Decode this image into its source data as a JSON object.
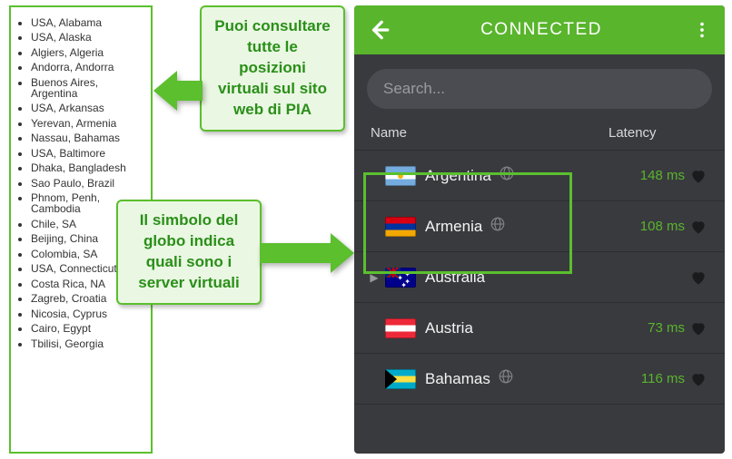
{
  "locations": [
    "USA, Alabama",
    "USA, Alaska",
    "Algiers, Algeria",
    "Andorra, Andorra",
    "Buenos Aires, Argentina",
    "USA, Arkansas",
    "Yerevan, Armenia",
    "Nassau, Bahamas",
    "USA, Baltimore",
    "Dhaka, Bangladesh",
    "Sao Paulo, Brazil",
    "Phnom, Penh, Cambodia",
    "Chile, SA",
    "Beijing, China",
    "Colombia, SA",
    "USA, Connecticut",
    "Costa Rica, NA",
    "Zagreb, Croatia",
    "Nicosia, Cyprus",
    "Cairo, Egypt",
    "Tbilisi, Georgia"
  ],
  "callouts": {
    "top": "Puoi consultare tutte le posizioni virtuali sul sito web di PIA",
    "bottom": "Il simbolo del globo indica quali sono i server virtuali"
  },
  "app": {
    "status": "CONNECTED",
    "search_placeholder": "Search...",
    "columns": {
      "name": "Name",
      "latency": "Latency"
    },
    "servers": [
      {
        "name": "Argentina",
        "latency": "148 ms",
        "flag": "flag-ar",
        "virtual": true,
        "expandable": false
      },
      {
        "name": "Armenia",
        "latency": "108 ms",
        "flag": "flag-am",
        "virtual": true,
        "expandable": false
      },
      {
        "name": "Australia",
        "latency": "",
        "flag": "flag-au",
        "virtual": false,
        "expandable": true
      },
      {
        "name": "Austria",
        "latency": "73 ms",
        "flag": "flag-at",
        "virtual": false,
        "expandable": false
      },
      {
        "name": "Bahamas",
        "latency": "116 ms",
        "flag": "flag-bs",
        "virtual": true,
        "expandable": false
      }
    ]
  },
  "colors": {
    "accent": "#59b52c",
    "highlight": "#5bbf2e"
  }
}
